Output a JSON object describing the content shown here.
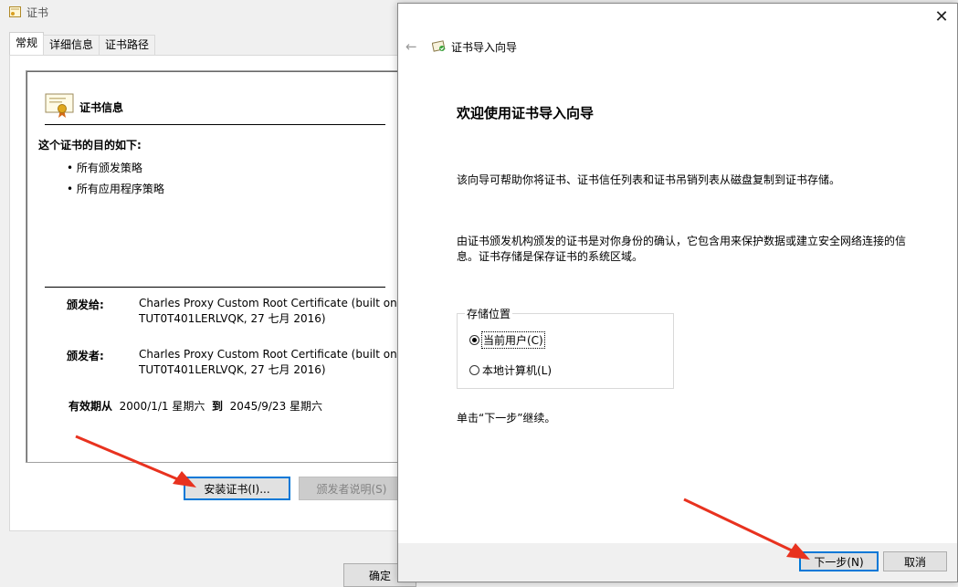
{
  "cert_window": {
    "title": "证书",
    "tabs": [
      "常规",
      "详细信息",
      "证书路径"
    ],
    "info_heading": "证书信息",
    "purpose_heading": "这个证书的目的如下:",
    "purposes": [
      "所有颁发策略",
      "所有应用程序策略"
    ],
    "issued_to_label": "颁发给:",
    "issued_to_line1": "Charles Proxy Custom Root Certificate (built on",
    "issued_to_line2": "TUT0T401LERLVQK, 27 七月 2016)",
    "issued_by_label": "颁发者:",
    "issued_by_line1": "Charles Proxy Custom Root Certificate (built on",
    "issued_by_line2": "TUT0T401LERLVQK, 27 七月 2016)",
    "validity_label": "有效期从",
    "valid_from": "2000/1/1 星期六",
    "validity_to": "到",
    "valid_to": "2045/9/23 星期六",
    "install_button": "安装证书(I)...",
    "issuer_statement_button": "颁发者说明(S)",
    "ok_button": "确定"
  },
  "wizard": {
    "title": "证书导入向导",
    "heading": "欢迎使用证书导入向导",
    "para1": "该向导可帮助你将证书、证书信任列表和证书吊销列表从磁盘复制到证书存储。",
    "para2_line1": "由证书颁发机构颁发的证书是对你身份的确认，它包含用来保护数据或建立安全网络连接的信",
    "para2_line2": "息。证书存储是保存证书的系统区域。",
    "store_location_label": "存储位置",
    "options": [
      "当前用户(C)",
      "本地计算机(L)"
    ],
    "selected_option": "当前用户(C)",
    "continue_hint": "单击“下一步”继续。",
    "next_button": "下一步(N)",
    "cancel_button": "取消"
  },
  "colors": {
    "annotation_arrow": "#e8321f",
    "focus_border": "#0078d7"
  }
}
